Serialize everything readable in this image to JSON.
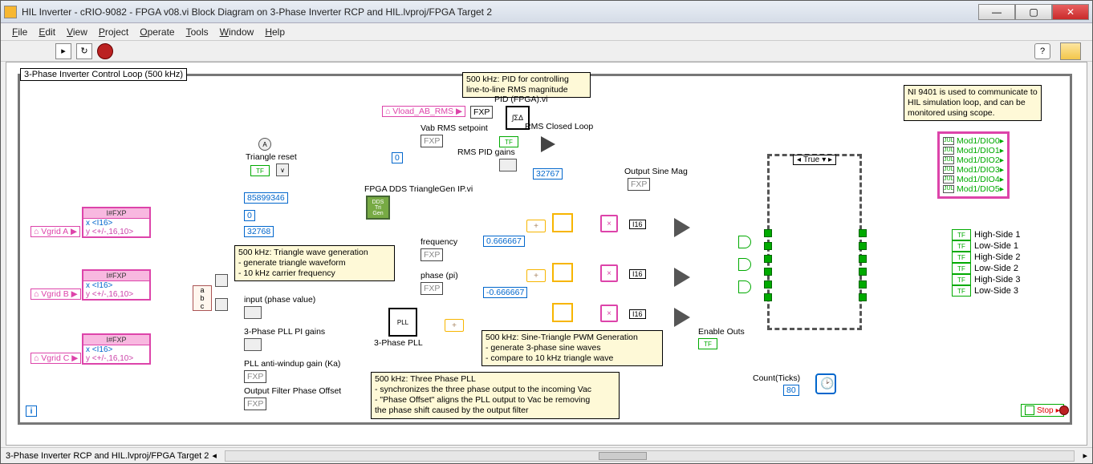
{
  "window": {
    "title": "HIL Inverter - cRIO-9082 - FPGA v08.vi Block Diagram on 3-Phase Inverter RCP and HIL.lvproj/FPGA Target 2"
  },
  "menu": {
    "file": "File",
    "edit": "Edit",
    "view": "View",
    "project": "Project",
    "operate": "Operate",
    "tools": "Tools",
    "window": "Window",
    "help": "Help"
  },
  "loop": {
    "label": "3-Phase Inverter Control Loop (500 kHz)"
  },
  "vgrid": {
    "a": "Vgrid A",
    "b": "Vgrid B",
    "c": "Vgrid C",
    "fxp": "I#FXP",
    "x": "x <I16>",
    "y": "y <+/-,16,10>"
  },
  "bundle": {
    "a": "a",
    "b": "b",
    "c": "c"
  },
  "triangle": {
    "reset_label": "Triangle reset",
    "dds_label": "FPGA DDS TriangleGen IP.vi",
    "c1": "85899346",
    "c2": "0",
    "c3": "32768",
    "note": "500 kHz: Triangle wave generation\n- generate triangle waveform\n- 10 kHz carrier frequency"
  },
  "pll": {
    "input_label": "input (phase value)",
    "gains_label": "3-Phase PLL PI gains",
    "ka_label": "PLL anti-windup gain (Ka)",
    "offset_label": "Output Filter Phase Offset",
    "subvi": "3-Phase PLL",
    "freq": "frequency",
    "phase": "phase (pi)",
    "note": "500 kHz: Three Phase PLL\n- synchronizes the three phase output to the incoming Vac\n- \"Phase Offset\" aligns the PLL output to Vac be removing\nthe phase shift caused by the output filter"
  },
  "pid": {
    "note": "500 kHz: PID for controlling\nline-to-line RMS magnitude",
    "vload": "Vload_AB_RMS",
    "fxp": "FXP",
    "vab_label": "Vab RMS setpoint",
    "gains_label": "RMS PID gains",
    "subvi_label": "PID (FPGA).vi",
    "closed_label": "RMS Closed Loop",
    "sat": "32767",
    "zero": "0"
  },
  "sine": {
    "mag_label": "Output Sine Mag",
    "phA": "0.666667",
    "phB": "-0.666667",
    "note": "500 kHz: Sine-Triangle PWM Generation\n- generate 3-phase sine waves\n- compare to 10 kHz triangle wave",
    "i16": "I16"
  },
  "case_sel": "True",
  "enable_label": "Enable Outs",
  "ticks_label": "Count(Ticks)",
  "ticks_val": "80",
  "ni_note": "NI 9401 is used to communicate to HIL simulation loop, and can be monitored using scope.",
  "dio": [
    "Mod1/DIO0",
    "Mod1/DIO1",
    "Mod1/DIO2",
    "Mod1/DIO3",
    "Mod1/DIO4",
    "Mod1/DIO5"
  ],
  "sides": [
    "High-Side 1",
    "Low-Side 1",
    "High-Side 2",
    "Low-Side 2",
    "High-Side 3",
    "Low-Side 3"
  ],
  "stop": "Stop",
  "status": "3-Phase Inverter RCP and HIL.lvproj/FPGA Target 2"
}
